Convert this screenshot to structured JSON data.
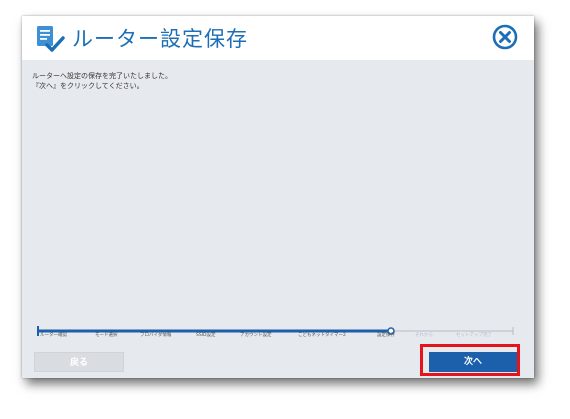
{
  "dialog": {
    "title": "ルーター設定保存",
    "message_lines": [
      "ルーターへ設定の保存を完了いたしました。",
      "『次へ』をクリックしてください。"
    ]
  },
  "steps": [
    {
      "label": "ルーター確認",
      "state": "done"
    },
    {
      "label": "モード選択",
      "state": "done"
    },
    {
      "label": "プロバイダ情報",
      "state": "done"
    },
    {
      "label": "SSID設定",
      "state": "done"
    },
    {
      "label": "アカウント設定",
      "state": "done"
    },
    {
      "label": "こどもネットタイマー2",
      "state": "done"
    },
    {
      "label": "設定保存",
      "state": "current"
    },
    {
      "label": "それから",
      "state": "todo"
    },
    {
      "label": "セットアップ完了",
      "state": "todo"
    }
  ],
  "buttons": {
    "back_label": "戻る",
    "next_label": "次へ"
  },
  "colors": {
    "accent": "#1c6fb6",
    "primary_button": "#1c5fab",
    "highlight": "#e3141b",
    "dialog_bg": "#e6e9ee"
  }
}
